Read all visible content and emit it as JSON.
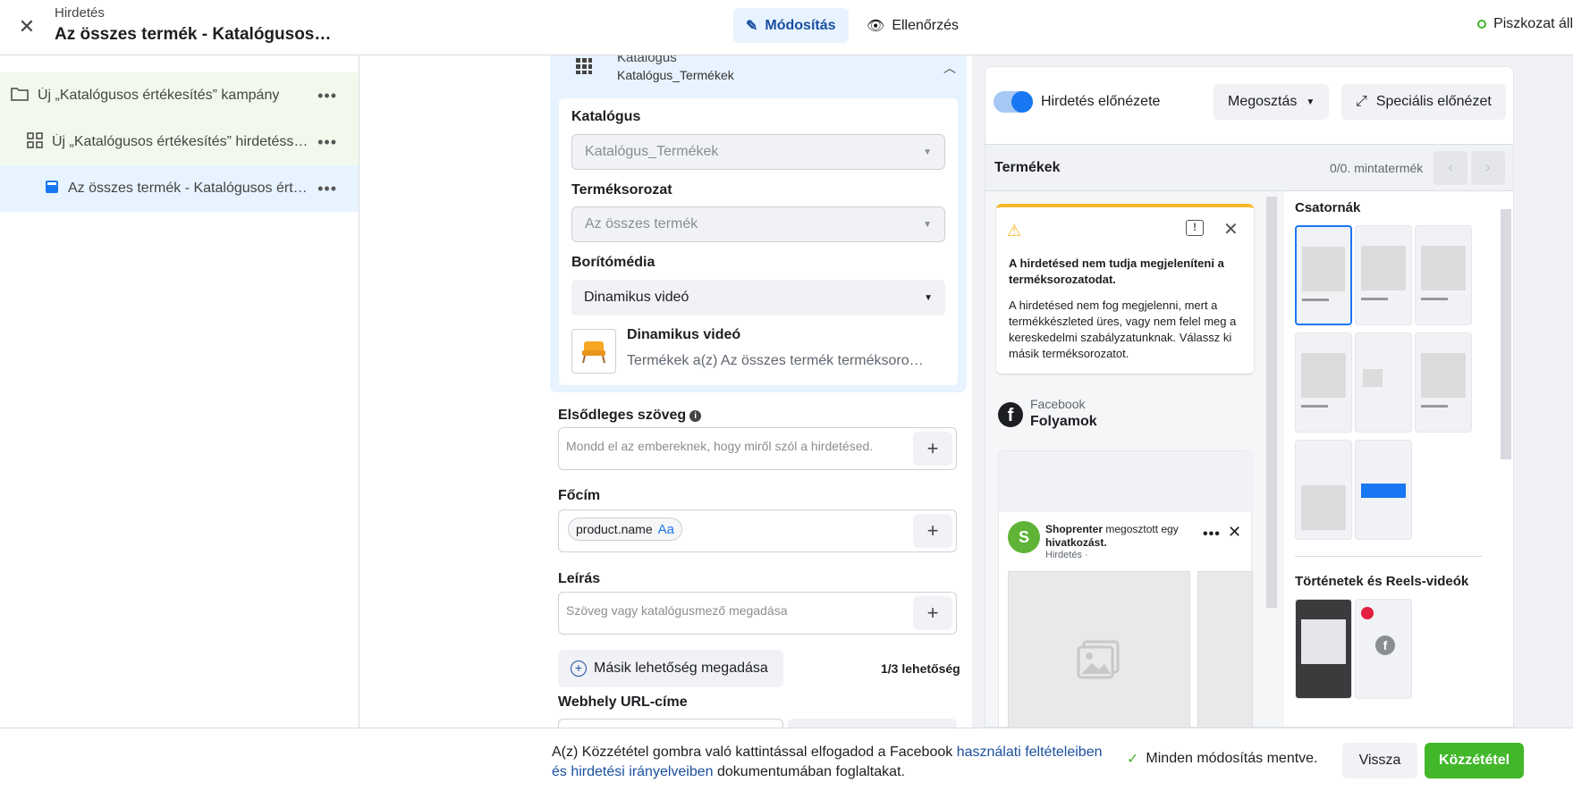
{
  "header": {
    "label": "Hirdetés",
    "title": "Az összes termék - Katalógusos…",
    "tab_edit": "Módosítás",
    "tab_review": "Ellenőrzés",
    "draft_status": "Piszkozat áll"
  },
  "tree": {
    "campaign": "Új „Katalógusos értékesítés” kampány",
    "adset": "Új „Katalógusos értékesítés” hirdetéss…",
    "ad": "Az összes termék - Katalógusos ért…"
  },
  "catalog_card": {
    "header_label": "Katalógus",
    "header_value": "Katalógus_Termékek",
    "catalog_label": "Katalógus",
    "catalog_value": "Katalógus_Termékek",
    "product_set_label": "Terméksorozat",
    "product_set_value": "Az összes termék",
    "cover_media_label": "Borítómédia",
    "cover_media_value": "Dinamikus videó",
    "media_title": "Dinamikus videó",
    "media_desc": "Termékek a(z) Az összes termék terméksoro…"
  },
  "fields": {
    "primary_text_label": "Elsődleges szöveg",
    "primary_text_placeholder": "Mondd el az embereknek, hogy miről szól a hirdetésed.",
    "headline_label": "Főcím",
    "headline_chip": "product.name",
    "headline_chip_tag": "Aa",
    "description_label": "Leírás",
    "description_placeholder": "Szöveg vagy katalógusmező megadása",
    "add_option": "Másik lehetőség megadása",
    "option_count": "1/3 lehetőség",
    "url_label": "Webhely URL-címe"
  },
  "preview": {
    "toggle_label": "Hirdetés előnézete",
    "share_button": "Megosztás",
    "advanced_button": "Speciális előnézet",
    "products_title": "Termékek",
    "sample_count": "0/0. mintatermék",
    "warning_title": "A hirdetésed nem tudja megjeleníteni a terméksorozatodat.",
    "warning_body": "A hirdetésed nem fog megjelenni, mert a termékkészleted üres, vagy nem felel meg a kereskedelmi szabályzatunknak. Válassz ki másik terméksorozatot.",
    "platform": "Facebook",
    "placement": "Folyamok",
    "post_author": "Shoprenter",
    "post_action": " megosztott egy ",
    "post_link": "hivatkozást.",
    "post_sub": "Hirdetés ·",
    "channels_title": "Csatornák",
    "stories_title": "Történetek és Reels-videók"
  },
  "footer": {
    "legal_pre": "A(z) Közzététel gombra való kattintással elfogadod a Facebook ",
    "legal_link": "használati feltételeiben és hirdetési irányelveiben",
    "legal_post": " dokumentumában foglaltakat.",
    "saved": "Minden módosítás mentve.",
    "back_button": "Vissza",
    "publish_button": "Közzététel"
  },
  "colors": {
    "accent": "#1877f2",
    "publish": "#42b72a",
    "warning": "#f7b928"
  }
}
